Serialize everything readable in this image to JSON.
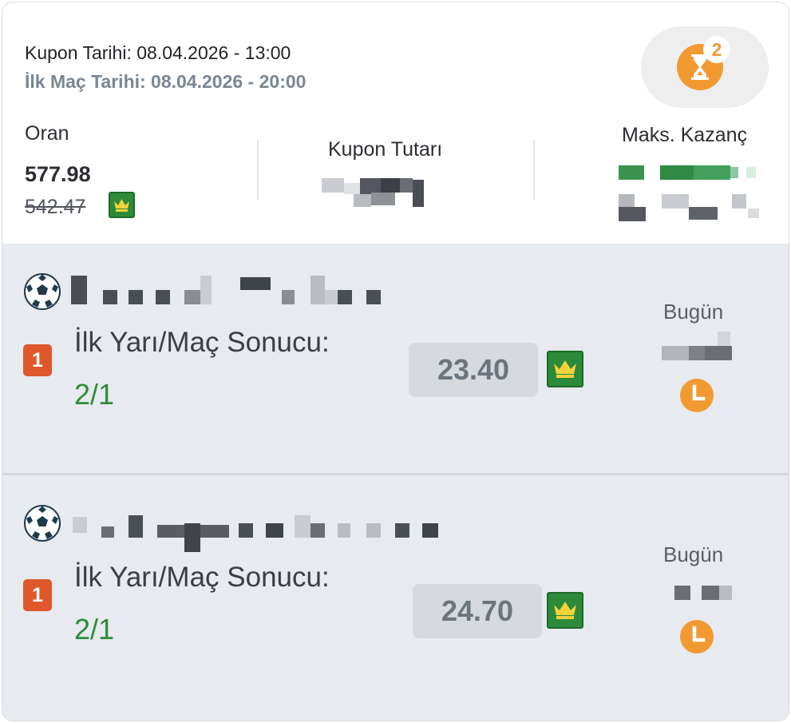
{
  "coupon": {
    "date_text": "Kupon Tarihi: 08.04.2026 - 13:00",
    "first_match_text": "İlk Maç Tarihi: 08.04.2026 - 20:00",
    "pending_count": "2"
  },
  "stats": {
    "odds_label": "Oran",
    "odds_value": "577.98",
    "odds_old": "542.47",
    "stake_label": "Kupon Tutarı",
    "max_win_label": "Maks. Kazanç"
  },
  "selections": [
    {
      "pick_no": "1",
      "market": "İlk Yarı/Maç Sonucu:",
      "pick": "2/1",
      "odd": "23.40",
      "day": "Bugün"
    },
    {
      "pick_no": "1",
      "market": "İlk Yarı/Maç Sonucu:",
      "pick": "2/1",
      "odd": "24.70",
      "day": "Bugün"
    }
  ],
  "icons": {
    "timer": "hourglass-icon",
    "sport": "soccer-ball-icon",
    "boost": "crown-icon",
    "time": "clock-icon"
  },
  "colors": {
    "accent_orange": "#f29a32",
    "pick_badge": "#e0572a",
    "pick_green": "#2f8a3e",
    "boost_green": "#2d8a3a"
  }
}
